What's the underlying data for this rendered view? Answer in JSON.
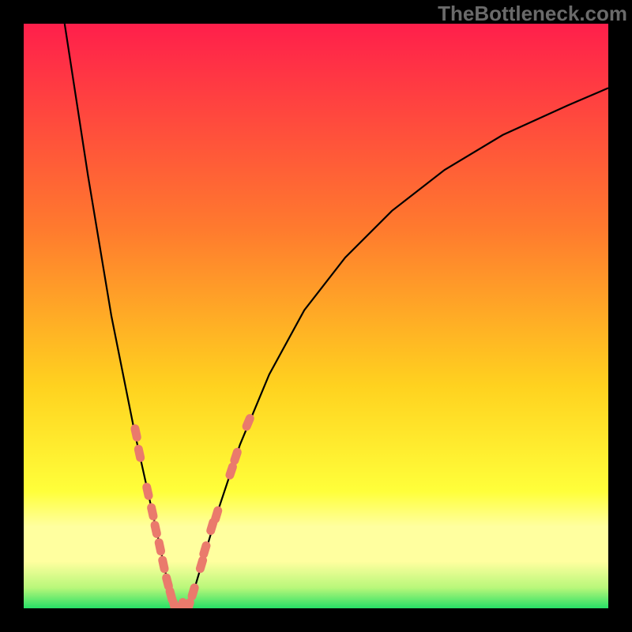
{
  "attribution": "TheBottleneck.com",
  "colors": {
    "frame": "#000000",
    "gradient_top": "#ff1f4b",
    "gradient_mid1": "#ff7a2e",
    "gradient_mid2": "#ffd21f",
    "gradient_band": "#ffff9f",
    "gradient_green": "#27e066",
    "curve": "#000000",
    "marker": "#ea7a6c"
  },
  "chart_data": {
    "type": "line",
    "title": "",
    "xlabel": "",
    "ylabel": "",
    "xlim": [
      0,
      100
    ],
    "ylim": [
      0,
      100
    ],
    "series": [
      {
        "name": "left-branch",
        "x": [
          7,
          9,
          11,
          13,
          15,
          17,
          19,
          21,
          23,
          24.5,
          25.8
        ],
        "y": [
          100,
          87,
          74,
          62,
          50,
          40,
          30,
          21,
          12,
          5,
          0
        ]
      },
      {
        "name": "right-branch",
        "x": [
          28.2,
          30,
          33,
          37,
          42,
          48,
          55,
          63,
          72,
          82,
          93,
          100
        ],
        "y": [
          0,
          6,
          16,
          28,
          40,
          51,
          60,
          68,
          75,
          81,
          86,
          89
        ]
      }
    ],
    "markers": [
      {
        "branch": "left",
        "x": 19.2,
        "y": 30.0
      },
      {
        "branch": "left",
        "x": 19.8,
        "y": 26.5
      },
      {
        "branch": "left",
        "x": 21.2,
        "y": 20.0
      },
      {
        "branch": "left",
        "x": 22.0,
        "y": 16.5
      },
      {
        "branch": "left",
        "x": 22.6,
        "y": 13.5
      },
      {
        "branch": "left",
        "x": 23.3,
        "y": 10.5
      },
      {
        "branch": "left",
        "x": 23.9,
        "y": 7.5
      },
      {
        "branch": "left",
        "x": 24.6,
        "y": 4.5
      },
      {
        "branch": "left",
        "x": 25.2,
        "y": 2.2
      },
      {
        "branch": "left",
        "x": 25.8,
        "y": 0.3
      },
      {
        "branch": "right",
        "x": 27.0,
        "y": 0.3
      },
      {
        "branch": "right",
        "x": 28.2,
        "y": 0.3
      },
      {
        "branch": "right",
        "x": 29.0,
        "y": 2.8
      },
      {
        "branch": "right",
        "x": 30.4,
        "y": 7.5
      },
      {
        "branch": "right",
        "x": 31.0,
        "y": 10.0
      },
      {
        "branch": "right",
        "x": 32.2,
        "y": 14.0
      },
      {
        "branch": "right",
        "x": 33.0,
        "y": 16.0
      },
      {
        "branch": "right",
        "x": 35.5,
        "y": 23.5
      },
      {
        "branch": "right",
        "x": 36.3,
        "y": 26.0
      },
      {
        "branch": "right",
        "x": 38.4,
        "y": 31.8
      }
    ],
    "legend": [],
    "grid": false
  }
}
